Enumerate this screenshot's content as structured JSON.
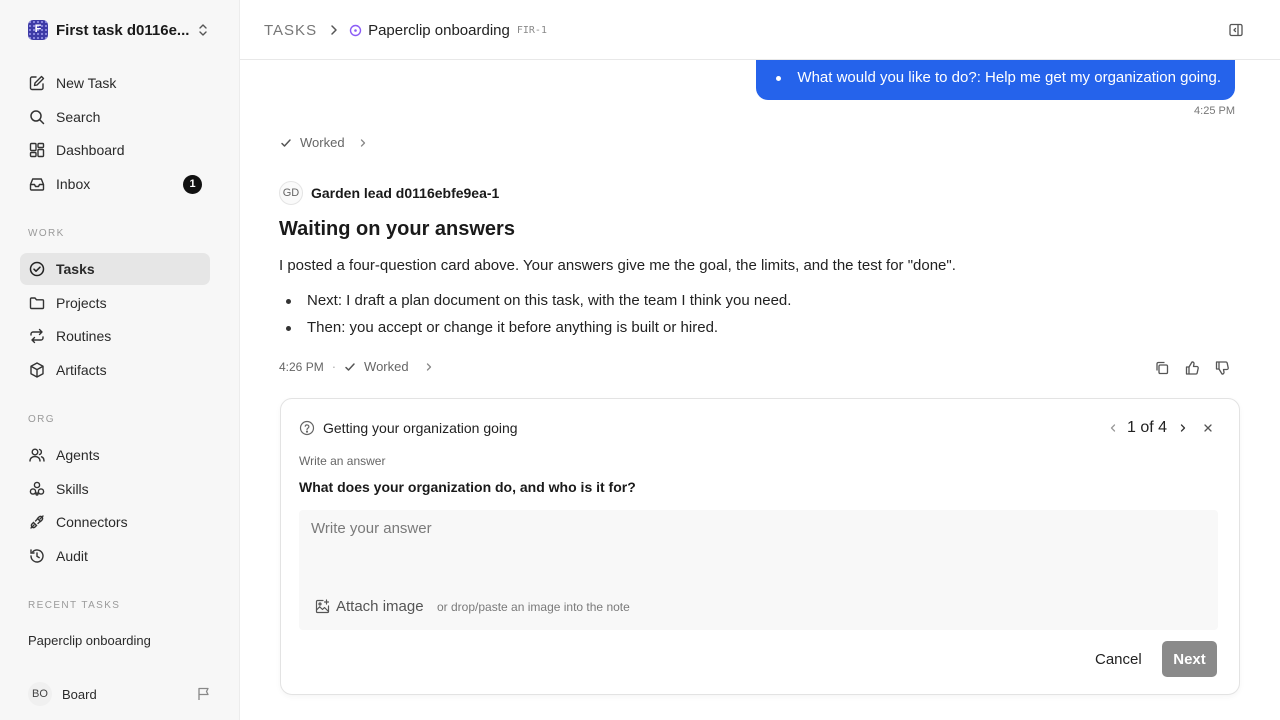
{
  "workspace": {
    "initial": "F",
    "name": "First task d0116e..."
  },
  "nav": {
    "new_task": "New Task",
    "search": "Search",
    "dashboard": "Dashboard",
    "inbox": "Inbox",
    "inbox_count": "1"
  },
  "sections": {
    "work": "WORK",
    "org": "ORG",
    "recent": "RECENT TASKS"
  },
  "work_items": {
    "tasks": "Tasks",
    "projects": "Projects",
    "routines": "Routines",
    "artifacts": "Artifacts"
  },
  "org_items": {
    "agents": "Agents",
    "skills": "Skills",
    "connectors": "Connectors",
    "audit": "Audit"
  },
  "recent": {
    "item1": "Paperclip onboarding"
  },
  "user": {
    "initials": "BO",
    "name": "Board"
  },
  "header": {
    "section": "TASKS",
    "title": "Paperclip onboarding",
    "task_id": "FIR-1"
  },
  "conversation": {
    "user_message": "What would you like to do?: Help me get my organization going.",
    "user_time": "4:25 PM",
    "worked_label": "Worked",
    "agent_initials": "GD",
    "agent_name": "Garden lead d0116ebfe9ea-1",
    "title": "Waiting on your answers",
    "body": "I posted a four-question card above. Your answers give me the goal, the limits, and the test for \"done\".",
    "bullets": [
      "Next: I draft a plan document on this task, with the team I think you need.",
      "Then: you accept or change it before anything is built or hired."
    ],
    "agent_time": "4:26 PM",
    "separator": "·",
    "worked_label2": "Worked"
  },
  "question_card": {
    "title": "Getting your organization going",
    "page": "1 of 4",
    "label": "Write an answer",
    "question": "What does your organization do, and who is it for?",
    "placeholder": "Write your answer",
    "attach_label": "Attach image",
    "attach_hint": "or drop/paste an image into the note",
    "cancel": "Cancel",
    "next": "Next"
  },
  "colors": {
    "accent": "#2563eb",
    "workspace_logo": "#3d3aa6",
    "status_purple": "#8b5cf6",
    "next_disabled": "#8a8a8a"
  },
  "icons": [
    "chevron-up-down-icon",
    "edit-icon",
    "search-icon",
    "dashboard-icon",
    "inbox-icon",
    "check-circle-icon",
    "folder-icon",
    "repeat-icon",
    "box-icon",
    "users-icon",
    "skills-icon",
    "plug-icon",
    "history-icon",
    "flag-icon",
    "chevron-right-icon",
    "status-circle-icon",
    "sidebar-panel-icon",
    "check-icon",
    "copy-icon",
    "thumbs-up-icon",
    "thumbs-down-icon",
    "help-circle-icon",
    "chevron-left-icon",
    "close-icon",
    "image-plus-icon"
  ]
}
